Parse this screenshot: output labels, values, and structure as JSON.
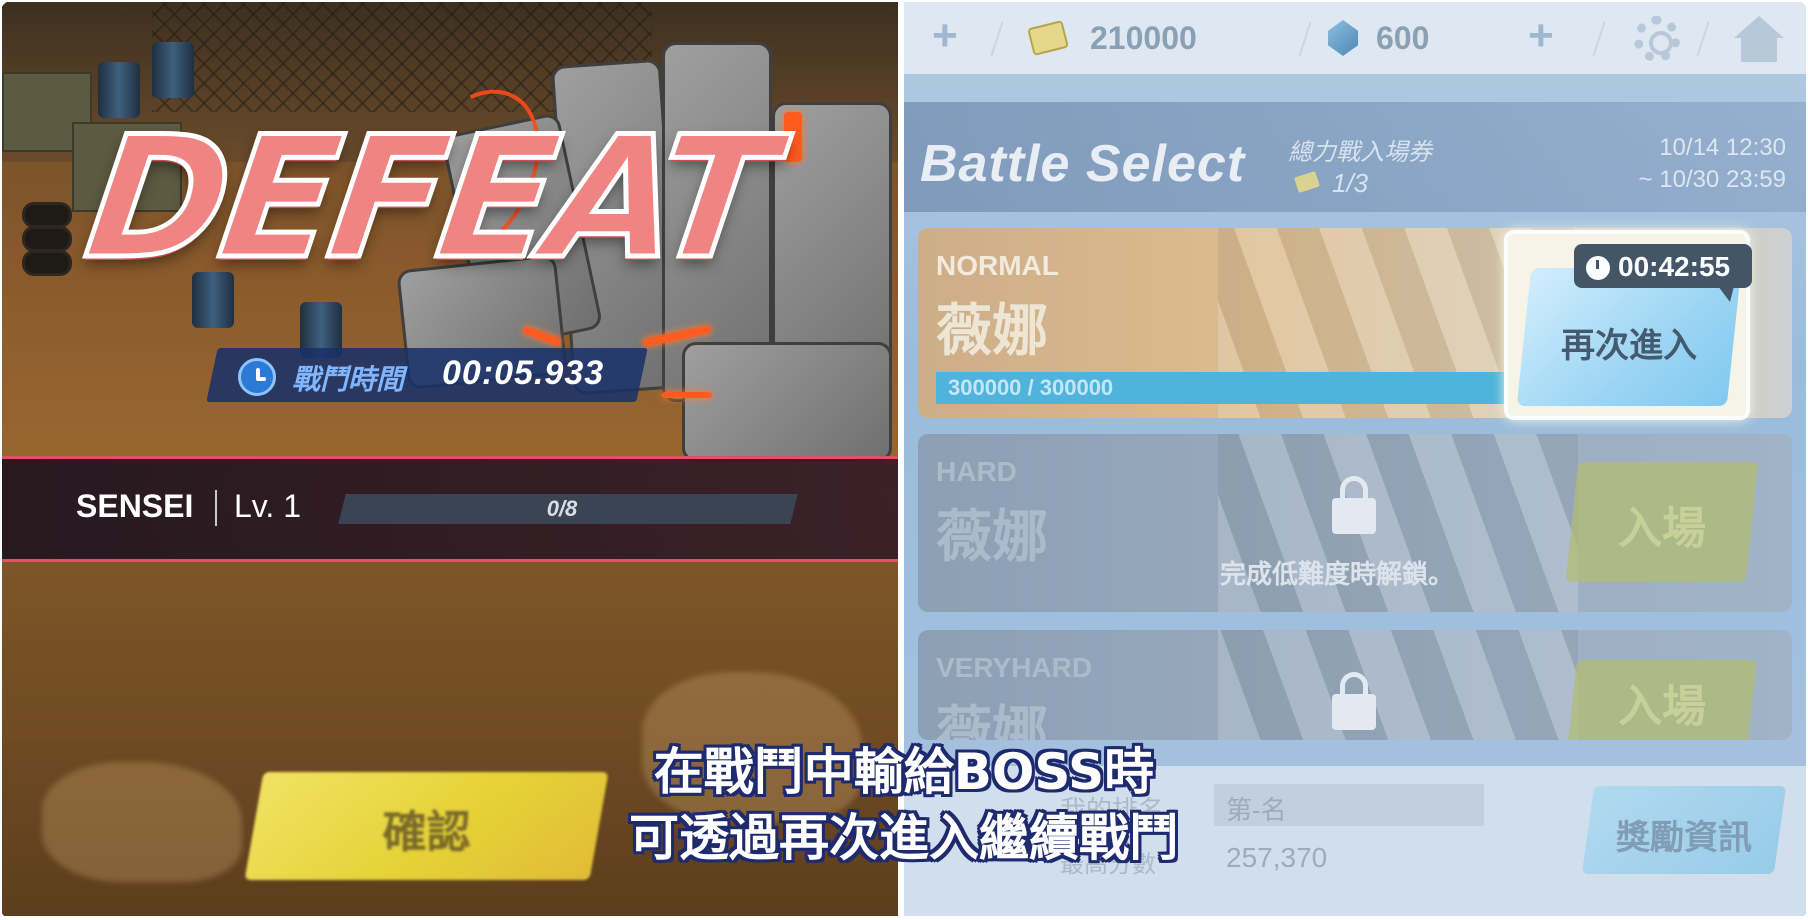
{
  "left_screen": {
    "title": "DEFEAT",
    "battle_time_label": "戰鬥時間",
    "battle_time_value": "00:05.933",
    "player_name": "SENSEI",
    "player_level": "Lv. 1",
    "exp_progress": "0/8",
    "confirm_label": "確認"
  },
  "right_screen": {
    "top_bar": {
      "credits": "210000",
      "gems": "600"
    },
    "header": {
      "title": "Battle Select",
      "ticket_label": "總力戰入場券",
      "ticket_count": "1/3",
      "date_start": "10/14 12:30",
      "date_end": "~ 10/30 23:59"
    },
    "cards": [
      {
        "difficulty": "NORMAL",
        "boss_name": "薇娜",
        "hp_text": "300000 / 300000",
        "hp_fraction": 1.0
      },
      {
        "difficulty": "HARD",
        "boss_name": "薇娜",
        "lock_text": "完成低難度時解鎖。",
        "enter_label": "入場"
      },
      {
        "difficulty": "VERYHARD",
        "boss_name": "薇娜",
        "enter_label": "入場"
      }
    ],
    "reenter": {
      "timer": "00:42:55",
      "label": "再次進入"
    },
    "footer": {
      "rank_label": "我的排名",
      "rank_value": "第-名",
      "score_label": "最高分數",
      "score_value": "257,370",
      "reward_label": "獎勵資訊"
    }
  },
  "subtitle": {
    "line1": "在戰鬥中輸給BOSS時",
    "line2": "可透過再次進入繼續戰鬥"
  },
  "colors": {
    "defeat_pink": "#f08482",
    "accent_red": "#e05066",
    "confirm_yellow": "#f4e23a",
    "hp_blue": "#2fa6d6",
    "subtitle_outline": "#1e2a6e"
  }
}
